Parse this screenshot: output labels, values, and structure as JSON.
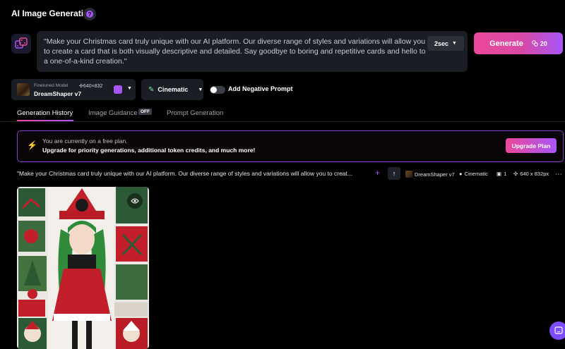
{
  "header": {
    "title": "AI Image Generation"
  },
  "prompt": {
    "text": "\"Make your Christmas card truly unique with our AI platform. Our diverse range of styles and variations will allow you to create a card that is both visually descriptive and detailed. Say goodbye to boring and repetitive cards and hello to a one-of-a-kind creation.\"",
    "time_option": "2sec"
  },
  "generate": {
    "label": "Generate",
    "cost": "20"
  },
  "model": {
    "tag": "Finetuned Model",
    "size": "640×832",
    "name": "DreamShaper v7"
  },
  "style": {
    "label": "Cinematic"
  },
  "negative_prompt": {
    "label": "Add Negative Prompt",
    "enabled": false
  },
  "tabs": [
    {
      "label": "Generation History",
      "active": true
    },
    {
      "label": "Image Guidance",
      "badge": "OFF"
    },
    {
      "label": "Prompt Generation"
    }
  ],
  "banner": {
    "line1": "You are currently on a free plan.",
    "line2": "Upgrade for priority generations, additional token credits, and much more!",
    "button": "Upgrade Plan"
  },
  "history": {
    "prompt": "\"Make your Christmas card truly unique with our AI platform. Our diverse range of styles and variations will allow you to creat...",
    "model": "DreamShaper v7",
    "style": "Cinematic",
    "count": "1",
    "dimensions": "640 x 832px"
  },
  "colors": {
    "accent_pink": "#ec4899",
    "accent_purple": "#a855f7",
    "background": "#000000"
  }
}
